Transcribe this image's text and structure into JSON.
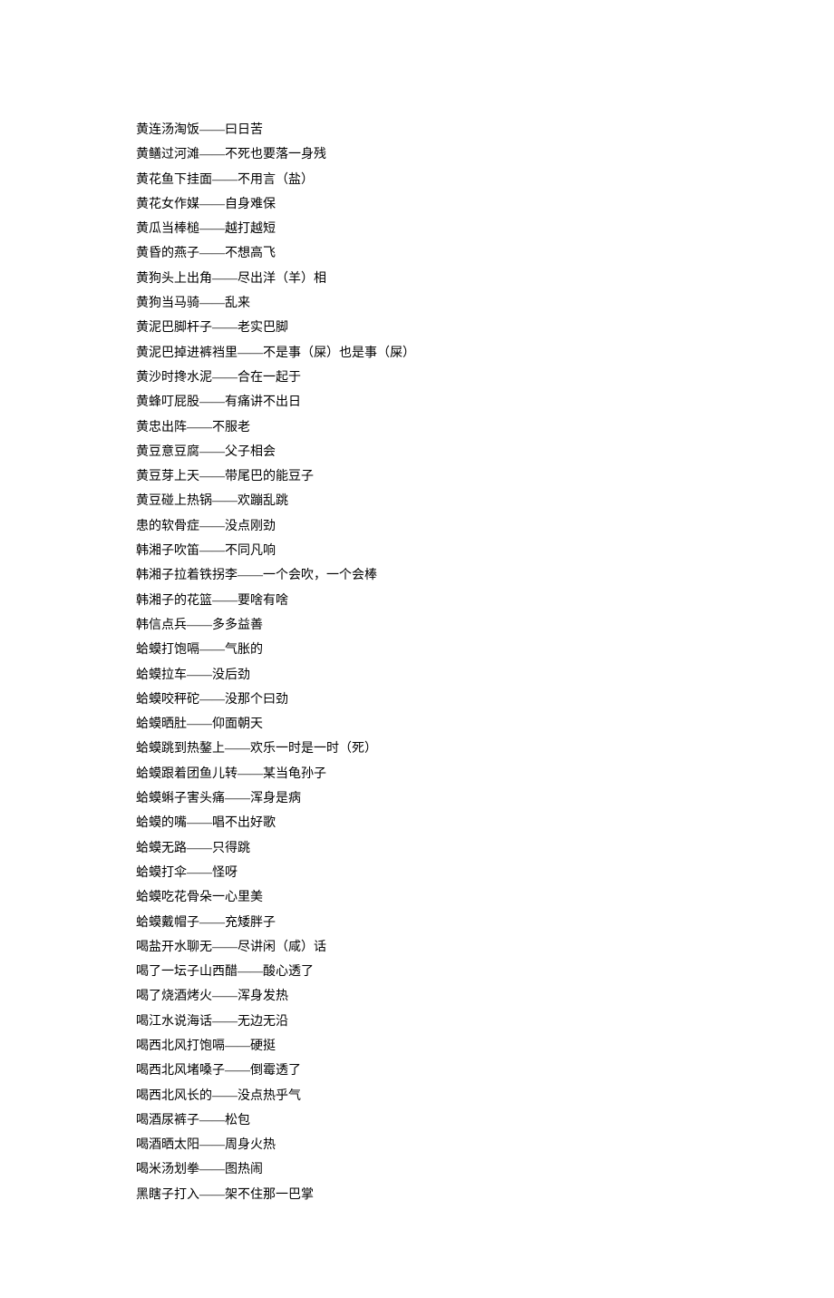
{
  "lines": [
    "黄连汤淘饭——曰日苦",
    "黄鳝过河滩——不死也要落一身残",
    "黄花鱼下挂面——不用言（盐）",
    "黄花女作媒——自身难保",
    "黄瓜当棒槌——越打越短",
    "黄昏的燕子——不想高飞",
    "黄狗头上出角——尽出洋（羊）相",
    "黄狗当马骑——乱来",
    "黄泥巴脚杆子——老实巴脚",
    "黄泥巴掉进裤裆里——不是事（屎）也是事（屎）",
    "黄沙时搀水泥——合在一起于",
    "黄蜂叮屁股——有痛讲不出日",
    "黄忠出阵——不服老",
    "黄豆意豆腐——父子相会",
    "黄豆芽上天——带尾巴的能豆子",
    "黄豆碰上热锅——欢蹦乱跳",
    "患的软骨症——没点刚劲",
    "韩湘子吹笛——不同凡响",
    "韩湘子拉着铁拐李——一个会吹，一个会棒",
    "韩湘子的花篮——要啥有啥",
    "韩信点兵——多多益善",
    "蛤蟆打饱嗝——气胀的",
    "蛤蟆拉车——没后劲",
    "蛤蟆咬秤砣——没那个曰劲",
    "蛤蟆晒肚——仰面朝天",
    "蛤蟆跳到热鏊上——欢乐一时是一时（死）",
    "蛤蟆跟着团鱼儿转——某当龟孙子",
    "蛤蟆蝌子害头痛——浑身是病",
    "蛤蟆的嘴——唱不出好歌",
    "蛤蟆无路——只得跳",
    "蛤蟆打伞——怪呀",
    "蛤蟆吃花骨朵一心里美",
    "蛤蟆戴帽子——充矮胖子",
    "喝盐开水聊无——尽讲闲（咸）话",
    "喝了一坛子山西醋——酸心透了",
    "喝了烧酒烤火——浑身发热",
    "喝江水说海话——无边无沿",
    "喝西北风打饱嗝——硬挺",
    "喝西北风堵嗓子——倒霉透了",
    "喝西北风长的——没点热乎气",
    "喝酒尿裤子——松包",
    "喝酒晒太阳——周身火热",
    "喝米汤划拳——图热闹",
    "黑瞎子打入——架不住那一巴掌"
  ]
}
